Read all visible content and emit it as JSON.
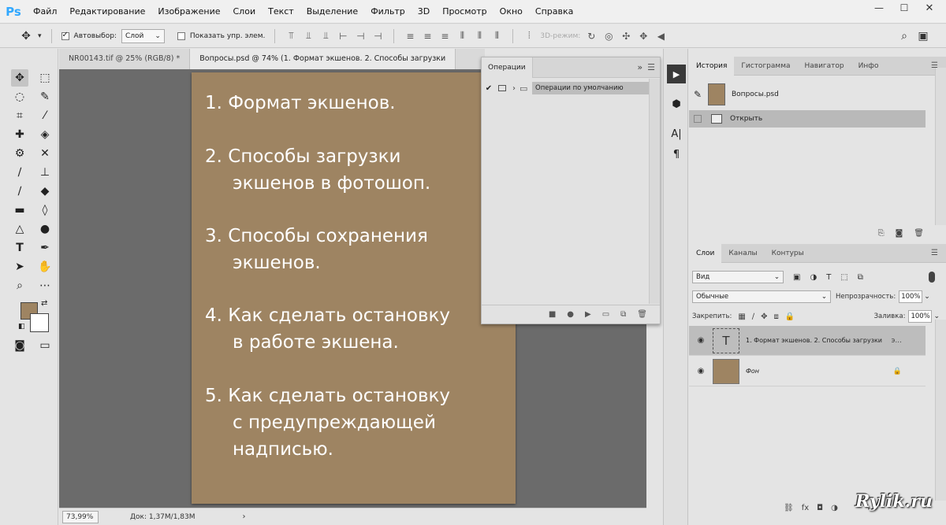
{
  "app": {
    "logo": "Ps"
  },
  "menu": [
    "Файл",
    "Редактирование",
    "Изображение",
    "Слои",
    "Текст",
    "Выделение",
    "Фильтр",
    "3D",
    "Просмотр",
    "Окно",
    "Справка"
  ],
  "window_controls": {
    "minimize": "—",
    "restore": "☐",
    "close": "✕"
  },
  "options": {
    "autoselect_label": "Автовыбор:",
    "autoselect_checked": true,
    "autoselect_target": "Слой",
    "show_controls_label": "Показать упр. элем.",
    "show_controls_checked": false,
    "mode_3d_label": "3D-режим:"
  },
  "tabs": [
    {
      "label": "NR00143.tif @ 25% (RGB/8) *",
      "close": "×",
      "active": false
    },
    {
      "label": "Вопросы.psd @ 74% (1. Формат экшенов.  2. Способы загрузки",
      "active": true
    }
  ],
  "canvas": {
    "items": [
      {
        "line1": "1. Формат экшенов.",
        "line2": ""
      },
      {
        "line1": "2. Способы загрузки",
        "line2": "экшенов в фотошоп."
      },
      {
        "line1": "3. Способы сохранения",
        "line2": "экшенов."
      },
      {
        "line1": "4. Как сделать остановку",
        "line2": "в работе экшена."
      },
      {
        "line1": "5. Как сделать остановку",
        "line2": "с предупреждающей",
        "line3": "надписью."
      }
    ],
    "color": "#9e8462"
  },
  "status": {
    "zoom": "73,99%",
    "doc": "Док: 1,37M/1,83M",
    "arrow": "›"
  },
  "actions_panel": {
    "tab": "Операции",
    "set_name": "Операции по умолчанию",
    "check": "✔",
    "expand": "›"
  },
  "history": {
    "tabs": [
      "История",
      "Гистограмма",
      "Навигатор",
      "Инфо"
    ],
    "snapshot_name": "Вопросы.psd",
    "state_name": "Открыть"
  },
  "layers": {
    "tabs": [
      "Слои",
      "Каналы",
      "Контуры"
    ],
    "kind_filter": "Вид",
    "blend_mode": "Обычные",
    "opacity_label": "Непрозрачность:",
    "opacity_value": "100%",
    "lock_label": "Закрепить:",
    "fill_label": "Заливка:",
    "fill_value": "100%",
    "items": [
      {
        "name": "1. Формат экшенов.  2. Способы загрузки",
        "type": "text",
        "thumb": "T",
        "extra": "э..."
      },
      {
        "name": "Фон",
        "type": "background",
        "extra": "🔒"
      }
    ]
  },
  "watermark": "Rylik.ru"
}
